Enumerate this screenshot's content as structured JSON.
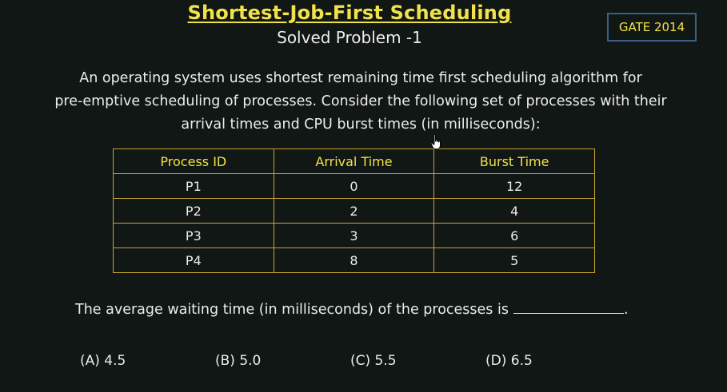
{
  "title": "Shortest-Job-First Scheduling",
  "subtitle": "Solved Problem -1",
  "badge": "GATE 2014",
  "paragraph": {
    "line1": "An operating system uses shortest remaining time first scheduling algorithm for",
    "line2": "pre-emptive scheduling of processes. Consider the following set of processes with their",
    "line3": "arrival times and CPU burst times (in milliseconds):"
  },
  "table": {
    "headers": [
      "Process ID",
      "Arrival Time",
      "Burst Time"
    ],
    "rows": [
      [
        "P1",
        "0",
        "12"
      ],
      [
        "P2",
        "2",
        "4"
      ],
      [
        "P3",
        "3",
        "6"
      ],
      [
        "P4",
        "8",
        "5"
      ]
    ]
  },
  "question": "The average waiting time (in milliseconds) of the processes is",
  "question_end": ".",
  "options": [
    "(A) 4.5",
    "(B) 5.0",
    "(C) 5.5",
    "(D) 6.5"
  ],
  "colors": {
    "background": "#111714",
    "title": "#f2e24a",
    "table_border": "#c7a532",
    "badge_border": "#3a5f86"
  },
  "icons": {
    "cursor": "hand-pointer-icon"
  }
}
